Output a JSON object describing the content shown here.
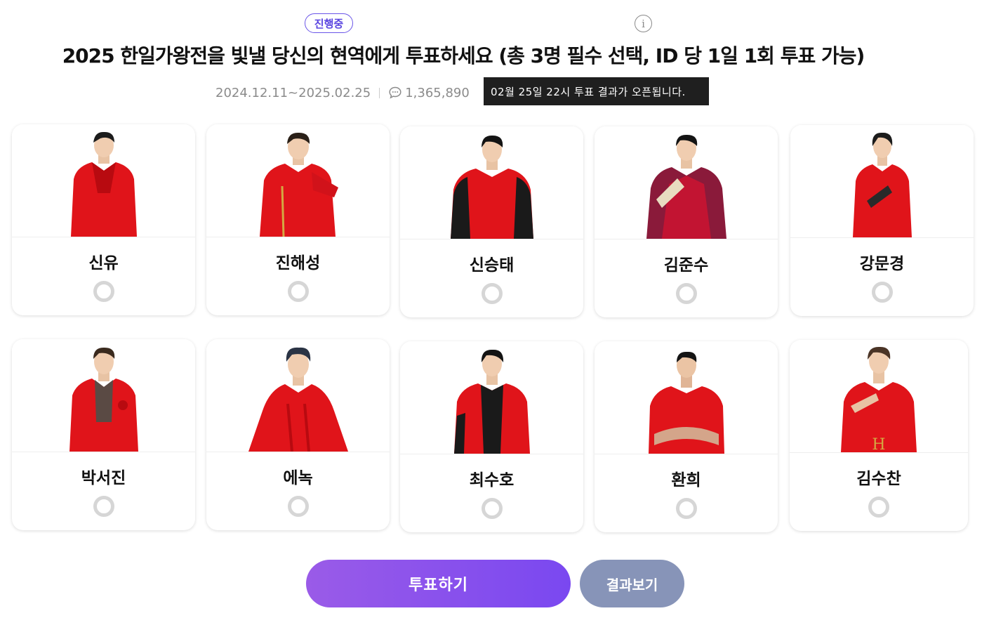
{
  "status_badge": "진행중",
  "title": "2025 한일가왕전을 빛낼 당신의 현역에게 투표하세요 (총 3명 필수 선택, ID 당 1일 1회 투표 가능)",
  "period": "2024.12.11~2025.02.25",
  "comment_count": "1,365,890",
  "tooltip": "02월 25일 22시 투표 결과가 오픈됩니다.",
  "icons": {
    "info": "info-icon",
    "comment": "comment-icon"
  },
  "colors": {
    "accent": "#6a55e8",
    "outfit_red": "#e0141a",
    "vote_button": "#8a52ee",
    "result_button": "#8794b8"
  },
  "candidates": [
    {
      "name": "신유",
      "selected": false
    },
    {
      "name": "진해성",
      "selected": false
    },
    {
      "name": "신승태",
      "selected": false
    },
    {
      "name": "김준수",
      "selected": false
    },
    {
      "name": "강문경",
      "selected": false
    },
    {
      "name": "박서진",
      "selected": false
    },
    {
      "name": "에녹",
      "selected": false
    },
    {
      "name": "최수호",
      "selected": false
    },
    {
      "name": "환희",
      "selected": false
    },
    {
      "name": "김수찬",
      "selected": false
    }
  ],
  "buttons": {
    "vote": "투표하기",
    "results": "결과보기"
  }
}
